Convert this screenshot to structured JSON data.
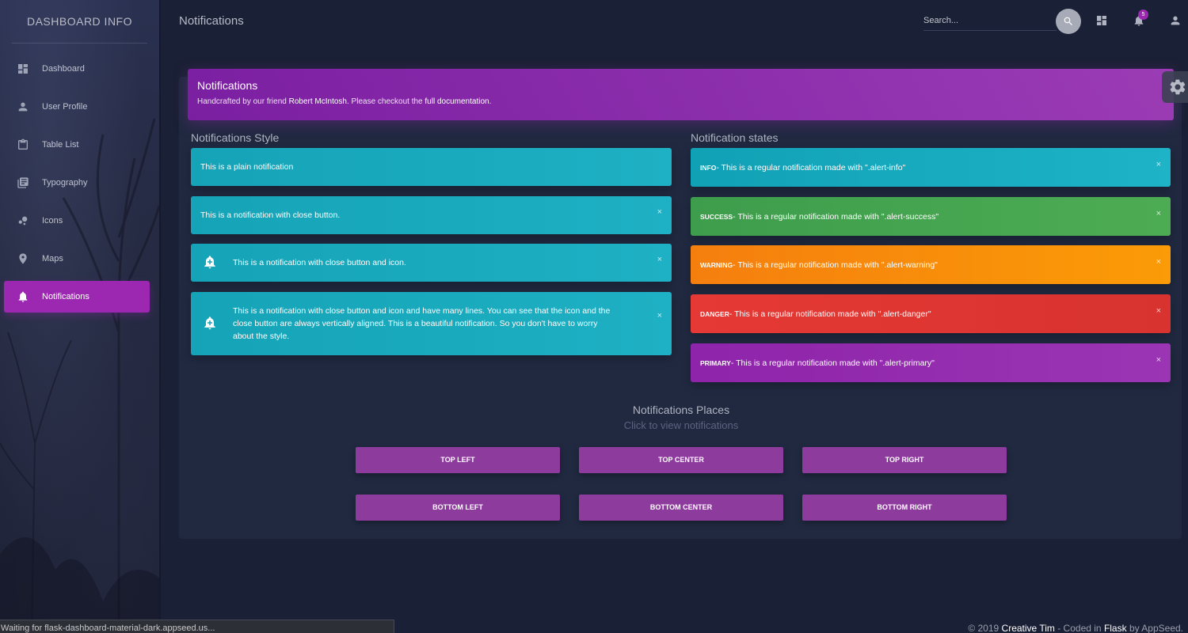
{
  "brand": "DASHBOARD INFO",
  "page_title": "Notifications",
  "sidebar": {
    "items": [
      {
        "label": "Dashboard",
        "icon": "dashboard-icon"
      },
      {
        "label": "User Profile",
        "icon": "person-icon"
      },
      {
        "label": "Table List",
        "icon": "clipboard-icon"
      },
      {
        "label": "Typography",
        "icon": "library-books-icon"
      },
      {
        "label": "Icons",
        "icon": "bubble-chart-icon"
      },
      {
        "label": "Maps",
        "icon": "location-pin-icon"
      },
      {
        "label": "Notifications",
        "icon": "bell-icon",
        "active": true
      }
    ]
  },
  "topbar": {
    "search_placeholder": "Search...",
    "notification_count": "5"
  },
  "header": {
    "title": "Notifications",
    "sub_prefix": "Handcrafted by our friend ",
    "sub_author": "Robert McIntosh",
    "sub_middle": ". Please checkout the ",
    "sub_link": "full documentation",
    "sub_end": "."
  },
  "styles": {
    "title": "Notifications Style",
    "plain": "This is a plain notification",
    "close": "This is a notification with close button.",
    "icon": "This is a notification with close button and icon.",
    "multi": "This is a notification with close button and icon and have many lines. You can see that the icon and the close button are always vertically aligned. This is a beautiful notification. So you don't have to worry about the style.",
    "close_glyph": "×"
  },
  "states": {
    "title": "Notification states",
    "items": [
      {
        "tag": "INFO",
        "text": " - This is a regular notification made with \".alert-info\"",
        "color": "#17a8bd"
      },
      {
        "tag": "SUCCESS",
        "text": " - This is a regular notification made with \".alert-success\"",
        "color": "#4caf50"
      },
      {
        "tag": "WARNING",
        "text": " - This is a regular notification made with \".alert-warning\"",
        "color": "#ff9800"
      },
      {
        "tag": "DANGER",
        "text": " - This is a regular notification made with \".alert-danger\"",
        "color": "#e53935"
      },
      {
        "tag": "PRIMARY",
        "text": " - This is a regular notification made with \".alert-primary\"",
        "color": "#9c27b0"
      }
    ]
  },
  "places": {
    "title": "Notifications Places",
    "subtitle": "Click to view notifications",
    "buttons": [
      "TOP LEFT",
      "TOP CENTER",
      "TOP RIGHT",
      "BOTTOM LEFT",
      "BOTTOM CENTER",
      "BOTTOM RIGHT"
    ]
  },
  "status_bar": "Waiting for flask-dashboard-material-dark.appseed.us...",
  "footer": {
    "prefix": "© 2019 ",
    "creative": "Creative Tim",
    "middle": " - Coded in ",
    "flask": "Flask",
    "end": " by AppSeed."
  }
}
